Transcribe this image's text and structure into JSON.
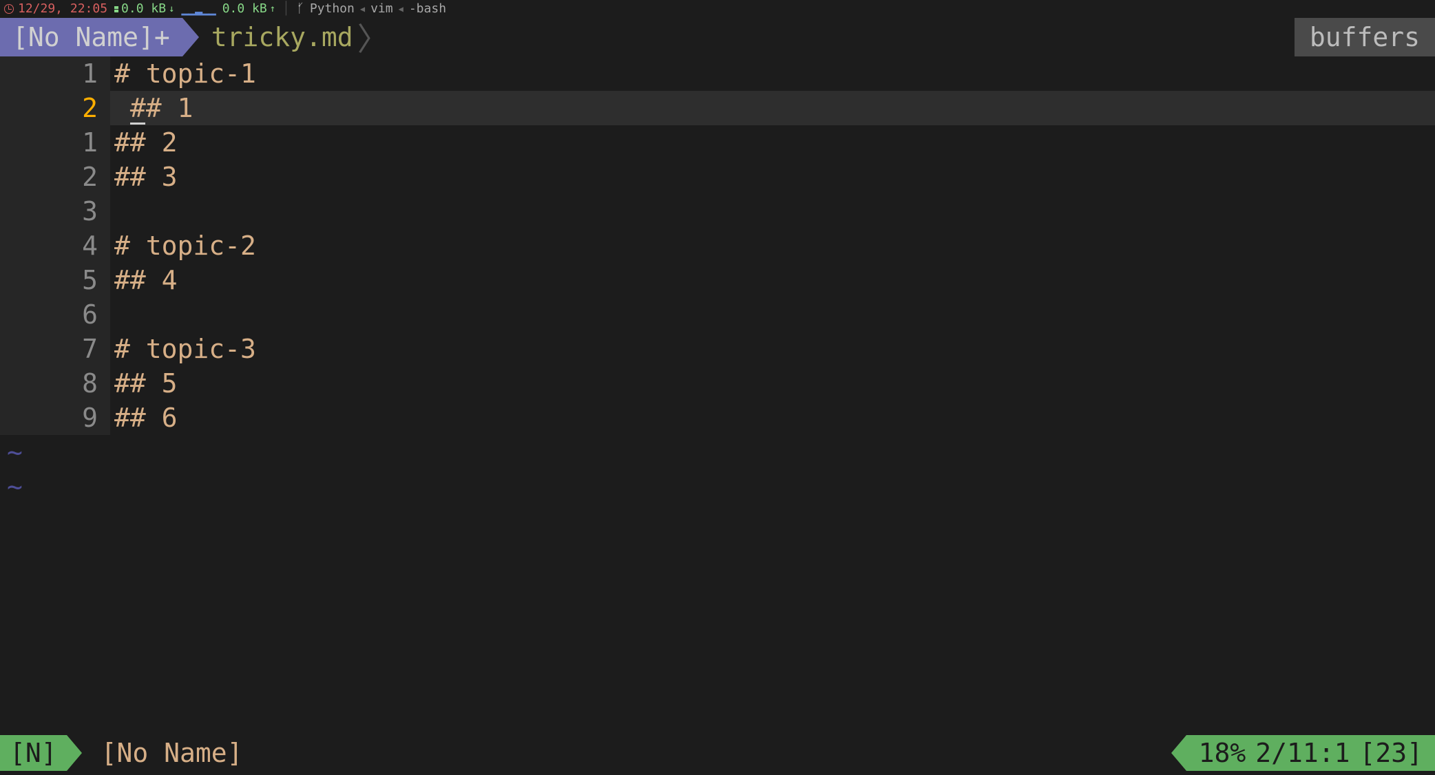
{
  "tmux": {
    "time": "12/29, 22:05",
    "net_down": "0.0 kB",
    "net_down_arrow": "↓",
    "graph": "▁▁▂▁▁",
    "net_up": "0.0 kB",
    "net_up_arrow": "↑",
    "crumbs": [
      "Python",
      "vim",
      "-bash"
    ]
  },
  "tabs": {
    "active": "[No Name]+",
    "inactive": "tricky.md",
    "right": "buffers"
  },
  "lines": [
    {
      "num": "1",
      "text": "# topic-1",
      "current": false
    },
    {
      "num": "2",
      "text": "## 1",
      "current": true,
      "pad": " "
    },
    {
      "num": "1",
      "text": "## 2",
      "current": false
    },
    {
      "num": "2",
      "text": "## 3",
      "current": false
    },
    {
      "num": "3",
      "text": "",
      "current": false
    },
    {
      "num": "4",
      "text": "# topic-2",
      "current": false
    },
    {
      "num": "5",
      "text": "## 4",
      "current": false
    },
    {
      "num": "6",
      "text": "",
      "current": false
    },
    {
      "num": "7",
      "text": "# topic-3",
      "current": false
    },
    {
      "num": "8",
      "text": "## 5",
      "current": false
    },
    {
      "num": "9",
      "text": "## 6",
      "current": false
    }
  ],
  "tilde": "~",
  "status": {
    "mode": "[N]",
    "name": "[No Name]",
    "percent": "18%",
    "pos": "2/11:1",
    "extra": "[23]"
  }
}
